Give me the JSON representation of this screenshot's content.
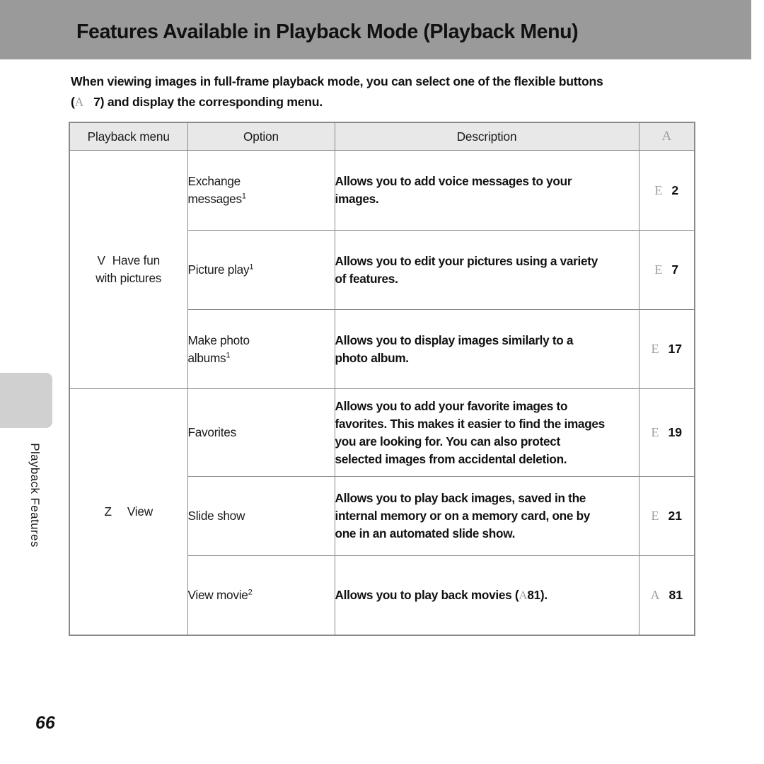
{
  "header": {
    "title": "Features Available in Playback Mode (Playback Menu)",
    "banner_color": "#9a9a9a"
  },
  "intro": {
    "line1": "When viewing images in full-frame playback mode, you can select one of the flexible buttons",
    "line2_prefix": "(",
    "line2_symbol": "A",
    "line2_page": "7",
    "line2_suffix": ") and display the corresponding menu."
  },
  "margin": {
    "tab_label": "Playback Features",
    "tab_color": "#d0d0d0"
  },
  "page_number": "66",
  "table": {
    "headers": {
      "menu": "Playback menu",
      "option": "Option",
      "description": "Description",
      "reference": "A"
    },
    "groups": [
      {
        "symbol": "V",
        "label": "Have fun with pictures",
        "label_line1": "Have fun",
        "label_line2": "with pictures",
        "rows": [
          {
            "option": "Exchange messages",
            "option_line1": "Exchange",
            "option_line2": "messages",
            "footnote": "1",
            "description": "Allows you to add voice messages to your images.",
            "description_line1": "Allows you to add voice messages to your",
            "description_line2": "images.",
            "ref_symbol": "E",
            "ref_page": "2"
          },
          {
            "option": "Picture play",
            "option_line1": "Picture play",
            "option_line2": "",
            "footnote": "1",
            "description": "Allows you to edit your pictures using a variety of features.",
            "description_line1": "Allows you to edit your pictures using a variety",
            "description_line2": "of features.",
            "ref_symbol": "E",
            "ref_page": "7"
          },
          {
            "option": "Make photo albums",
            "option_line1": "Make photo",
            "option_line2": "albums",
            "footnote": "1",
            "description": "Allows you to display images similarly to a photo album.",
            "description_line1": "Allows you to display images similarly to a",
            "description_line2": "photo album.",
            "ref_symbol": "E",
            "ref_page": "17"
          }
        ]
      },
      {
        "symbol": "Z",
        "label": "View",
        "label_line1": "View",
        "label_line2": "",
        "rows": [
          {
            "option": "Favorites",
            "option_line1": "Favorites",
            "option_line2": "",
            "footnote": "",
            "description": "Allows you to add your favorite images to favorites. This makes it easier to find the images you are looking for. You can also protect selected images from accidental deletion.",
            "description_line1": "Allows you to add your favorite images to",
            "description_line2": "favorites. This makes it easier to find the images",
            "description_line3": "you are looking for. You can also protect",
            "description_line4": "selected images from accidental deletion.",
            "ref_symbol": "E",
            "ref_page": "19"
          },
          {
            "option": "Slide show",
            "option_line1": "Slide show",
            "option_line2": "",
            "footnote": "",
            "description": "Allows you to play back images, saved in the internal memory or on a memory card, one by one in an automated slide show.",
            "description_line1": "Allows you to play back images, saved in the",
            "description_line2": "internal memory or on a memory card, one by",
            "description_line3": "one in an automated slide show.",
            "ref_symbol": "E",
            "ref_page": "21"
          },
          {
            "option": "View movie",
            "option_line1": "View movie",
            "option_line2": "",
            "footnote": "2",
            "description_prefix": "Allows you to play back movies (",
            "description_symbol": "A",
            "description_inline_page": "81",
            "description_suffix": ").",
            "ref_symbol": "A",
            "ref_page": "81"
          }
        ]
      }
    ]
  }
}
